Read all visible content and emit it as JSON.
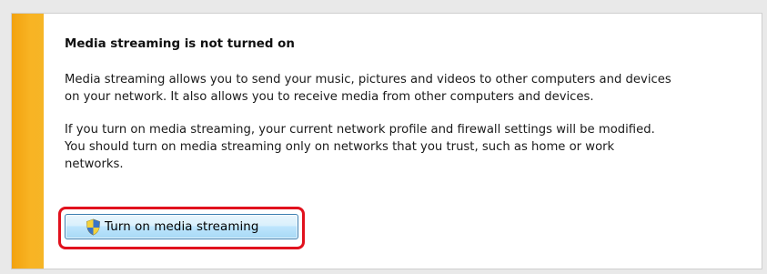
{
  "panel": {
    "title": "Media streaming is not turned on",
    "description": "Media streaming allows you to send your music, pictures and videos to other computers and devices\non your network.  It also allows you to receive media from other computers and devices.",
    "warning": "If you turn on media streaming, your current network profile and firewall settings will be modified.\nYou should turn on media streaming only on networks that you trust, such as home or work\nnetworks.",
    "button_label": "Turn on media streaming",
    "button_icon": "uac-shield-icon"
  },
  "colors": {
    "accent_bar": "#f8b424",
    "highlight": "#e1111d",
    "button_border": "#3c7fb1"
  }
}
